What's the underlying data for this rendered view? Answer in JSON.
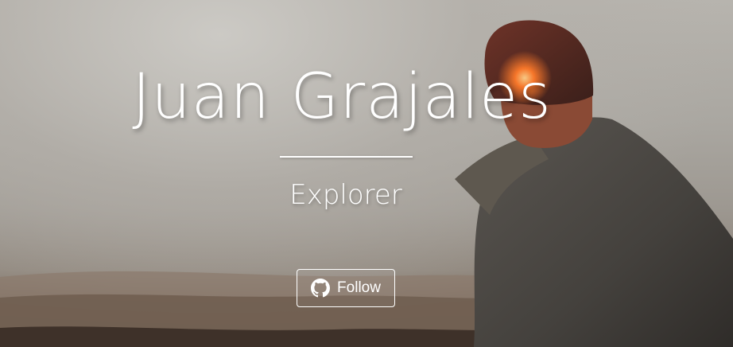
{
  "profile": {
    "name": "Juan Grajales",
    "role": "Explorer"
  },
  "follow_button": {
    "label": "Follow",
    "icon": "github-icon"
  },
  "colors": {
    "text": "#ffffff",
    "button_border": "#ffffff",
    "coat": "#4a4844",
    "hat": "#5a2a22",
    "sun_glow": "#ff7a2a"
  }
}
